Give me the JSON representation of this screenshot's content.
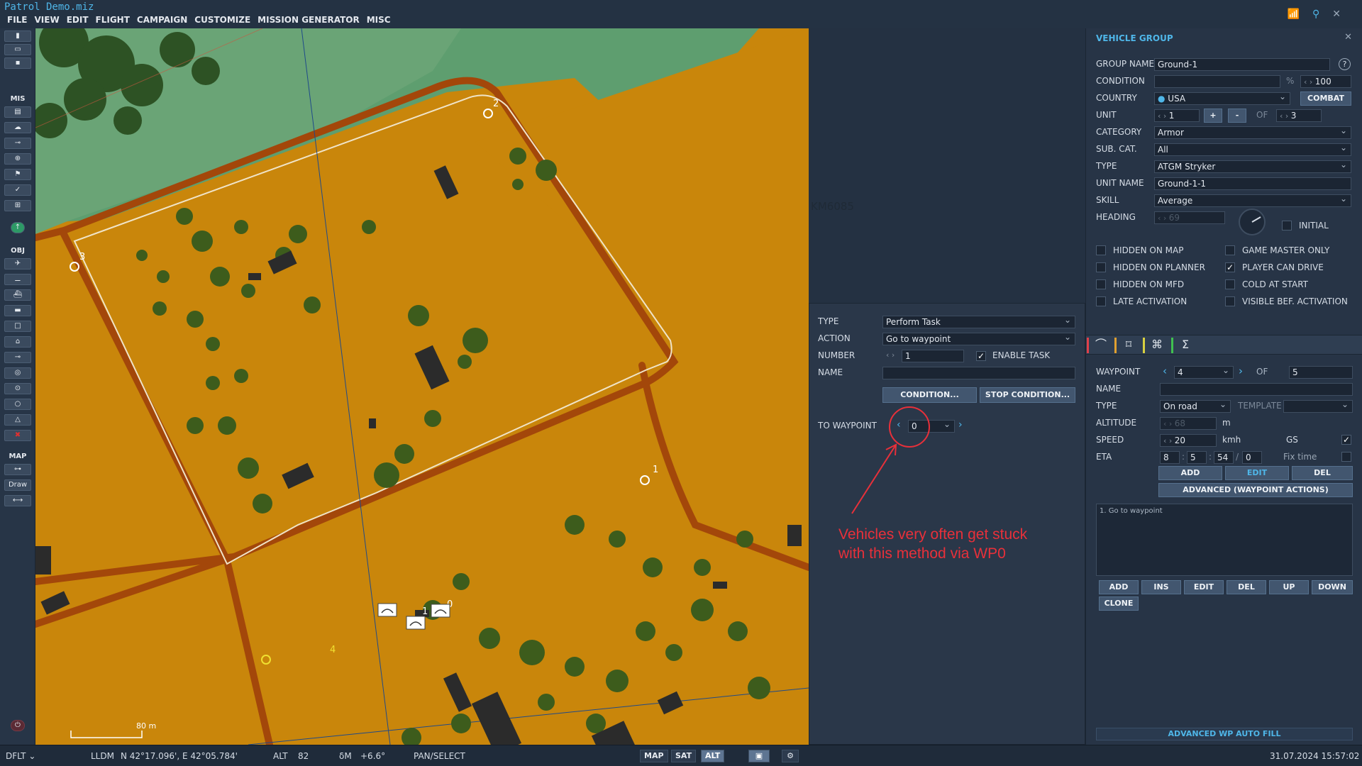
{
  "window": {
    "title": "Patrol Demo.miz"
  },
  "menu": [
    "FILE",
    "VIEW",
    "EDIT",
    "FLIGHT",
    "CAMPAIGN",
    "CUSTOMIZE",
    "MISSION GENERATOR",
    "MISC"
  ],
  "toolbar": {
    "section_mis": "MIS",
    "section_obj": "OBJ",
    "section_map": "MAP",
    "draw_label": "Draw"
  },
  "map": {
    "grid_label": "KM6085",
    "scale_label": "80 m",
    "waypoint_labels": [
      "0",
      "1",
      "2",
      "3",
      "4"
    ],
    "unit_label": "1"
  },
  "task_panel": {
    "type_label": "TYPE",
    "type_value": "Perform Task",
    "action_label": "ACTION",
    "action_value": "Go to waypoint",
    "number_label": "NUMBER",
    "number_value": "1",
    "enable_task_label": "ENABLE TASK",
    "enable_task_checked": true,
    "name_label": "NAME",
    "name_value": "",
    "condition_button": "CONDITION...",
    "stop_condition_button": "STOP CONDITION...",
    "to_waypoint_label": "TO WAYPOINT",
    "to_waypoint_value": "0"
  },
  "annotation": {
    "line1": "Vehicles very often get stuck",
    "line2": "with this method via WP0",
    "color": "#e8303a"
  },
  "vehicle_group": {
    "title": "VEHICLE GROUP",
    "group_name_label": "GROUP NAME",
    "group_name_value": "Ground-1",
    "condition_label": "CONDITION",
    "condition_unit": "%",
    "condition_value": "100",
    "country_label": "COUNTRY",
    "country_value": "USA",
    "combat_button": "COMBAT",
    "unit_label": "UNIT",
    "unit_value": "1",
    "unit_of": "OF",
    "unit_total": "3",
    "plus": "+",
    "minus": "-",
    "category_label": "CATEGORY",
    "category_value": "Armor",
    "subcat_label": "SUB. CAT.",
    "subcat_value": "All",
    "type_label": "TYPE",
    "type_value": "ATGM Stryker",
    "unit_name_label": "UNIT NAME",
    "unit_name_value": "Ground-1-1",
    "skill_label": "SKILL",
    "skill_value": "Average",
    "heading_label": "HEADING",
    "heading_value": "69",
    "initial_label": "INITIAL",
    "checks": [
      {
        "label": "HIDDEN ON MAP",
        "checked": false
      },
      {
        "label": "GAME MASTER ONLY",
        "checked": false
      },
      {
        "label": "HIDDEN ON PLANNER",
        "checked": false
      },
      {
        "label": "PLAYER CAN DRIVE",
        "checked": true
      },
      {
        "label": "HIDDEN ON MFD",
        "checked": false
      },
      {
        "label": "COLD AT START",
        "checked": false
      },
      {
        "label": "LATE ACTIVATION",
        "checked": false
      },
      {
        "label": "VISIBLE BEF. ACTIVATION",
        "checked": false
      }
    ]
  },
  "waypoint_panel": {
    "tab_icons": [
      "route-icon",
      "target-icon",
      "nodes-icon",
      "sigma-icon"
    ],
    "waypoint_label": "WAYPOINT",
    "waypoint_value": "4",
    "of_label": "OF",
    "of_value": "5",
    "name_label": "NAME",
    "name_value": "",
    "type_label": "TYPE",
    "type_value": "On road",
    "template_label": "TEMPLATE",
    "altitude_label": "ALTITUDE",
    "altitude_value": "68",
    "altitude_unit": "m",
    "speed_label": "SPEED",
    "speed_value": "20",
    "speed_unit": "kmh",
    "gs_label": "GS",
    "gs_checked": true,
    "eta_label": "ETA",
    "eta_h": "8",
    "eta_m": "5",
    "eta_s": "54",
    "eta_d": "0",
    "fix_time_label": "Fix time",
    "add": "ADD",
    "edit": "EDIT",
    "del": "DEL",
    "advanced": "ADVANCED (WAYPOINT ACTIONS)",
    "actions": [
      "1. Go to waypoint"
    ],
    "list_buttons": {
      "add": "ADD",
      "ins": "INS",
      "edit": "EDIT",
      "del": "DEL",
      "up": "UP",
      "down": "DOWN",
      "clone": "CLONE"
    },
    "auto_fill": "ADVANCED WP AUTO FILL"
  },
  "statusbar": {
    "profile": "DFLT",
    "coord_mode": "LLDM",
    "coords": "N 42°17.096', E 42°05.784'",
    "alt_label": "ALT",
    "alt_value": "82",
    "dm_label": "δM",
    "dm_value": "+6.6°",
    "mode": "PAN/SELECT",
    "map_btn": "MAP",
    "sat_btn": "SAT",
    "alt_btn": "ALT",
    "datetime": "31.07.2024 15:57:02"
  }
}
